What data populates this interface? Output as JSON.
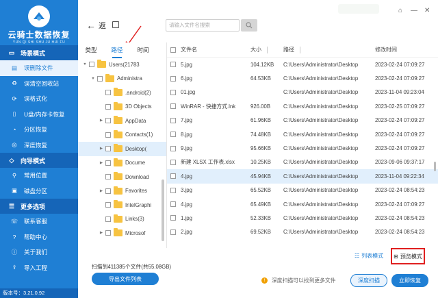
{
  "app": {
    "title": "云骑士数据恢复",
    "subtitle": "YUN QI SHI SHU JU HUI FU",
    "version": "版本号：3.21.0.92"
  },
  "sidebar": {
    "sections": [
      {
        "title": "场景模式",
        "items": [
          {
            "label": "误删除文件",
            "active": true
          },
          {
            "label": "误清空回收站"
          },
          {
            "label": "误格式化"
          },
          {
            "label": "U盘/内存卡恢复"
          },
          {
            "label": "分区恢复"
          },
          {
            "label": "深度恢复"
          }
        ]
      },
      {
        "title": "向导模式",
        "items": [
          {
            "label": "常用位置"
          },
          {
            "label": "磁盘分区"
          }
        ]
      },
      {
        "title": "更多选项",
        "items": [
          {
            "label": "联系客服"
          },
          {
            "label": "帮助中心"
          },
          {
            "label": "关于我们"
          },
          {
            "label": "导入工程"
          }
        ]
      }
    ]
  },
  "toolbar": {
    "back_label": "返",
    "search_placeholder": "请输入文件名搜索"
  },
  "tree": {
    "tabs": [
      "类型",
      "路径",
      "时间"
    ],
    "active_tab": 1,
    "rows": [
      {
        "label": "Users(21783",
        "indent": 0,
        "expand": "▼"
      },
      {
        "label": "Administra",
        "indent": 1,
        "expand": "▼"
      },
      {
        "label": ".android(2)",
        "indent": 2,
        "expand": ""
      },
      {
        "label": "3D Objects",
        "indent": 2,
        "expand": ""
      },
      {
        "label": "AppData",
        "indent": 2,
        "expand": "▶"
      },
      {
        "label": "Contacts(1)",
        "indent": 2,
        "expand": ""
      },
      {
        "label": "Desktop(",
        "indent": 2,
        "expand": "▶",
        "selected": true
      },
      {
        "label": "Docume",
        "indent": 2,
        "expand": "▶"
      },
      {
        "label": "Download",
        "indent": 2,
        "expand": ""
      },
      {
        "label": "Favorites",
        "indent": 2,
        "expand": "▶"
      },
      {
        "label": "IntelGraphi",
        "indent": 2,
        "expand": ""
      },
      {
        "label": "Links(3)",
        "indent": 2,
        "expand": ""
      },
      {
        "label": "Microsof",
        "indent": 2,
        "expand": "▶"
      }
    ]
  },
  "files": {
    "columns": [
      "文件名",
      "大小",
      "路径",
      "修改时间"
    ],
    "rows": [
      {
        "name": "5.jpg",
        "size": "104.12KB",
        "path": "C:\\Users\\Administrator\\Desktop",
        "date": "2023-02-24 07:09:27"
      },
      {
        "name": "6.jpg",
        "size": "64.53KB",
        "path": "C:\\Users\\Administrator\\Desktop",
        "date": "2023-02-24 07:09:27"
      },
      {
        "name": "01.jpg",
        "size": "",
        "path": "C:\\Users\\Administrator\\Desktop",
        "date": "2023-11-04 09:23:04"
      },
      {
        "name": "WinRAR - 快捷方式.lnk",
        "size": "926.00B",
        "path": "C:\\Users\\Administrator\\Desktop",
        "date": "2023-02-25 07:09:27"
      },
      {
        "name": "7.jpg",
        "size": "61.96KB",
        "path": "C:\\Users\\Administrator\\Desktop",
        "date": "2023-02-24 07:09:27"
      },
      {
        "name": "8.jpg",
        "size": "74.48KB",
        "path": "C:\\Users\\Administrator\\Desktop",
        "date": "2023-02-24 07:09:27"
      },
      {
        "name": "9.jpg",
        "size": "95.66KB",
        "path": "C:\\Users\\Administrator\\Desktop",
        "date": "2023-02-24 07:09:27"
      },
      {
        "name": "新建 XLSX 工作表.xlsx",
        "size": "10.25KB",
        "path": "C:\\Users\\Administrator\\Desktop",
        "date": "2023-09-06 09:37:17"
      },
      {
        "name": "4.jpg",
        "size": "45.94KB",
        "path": "C:\\Users\\Administrator\\Desktop",
        "date": "2023-11-04 09:22:34",
        "selected": true
      },
      {
        "name": "3.jpg",
        "size": "65.52KB",
        "path": "C:\\Users\\Administrator\\Desktop",
        "date": "2023-02-24 08:54:23"
      },
      {
        "name": "4.jpg",
        "size": "65.49KB",
        "path": "C:\\Users\\Administrator\\Desktop",
        "date": "2023-02-24 07:09:27"
      },
      {
        "name": "1.jpg",
        "size": "52.33KB",
        "path": "C:\\Users\\Administrator\\Desktop",
        "date": "2023-02-24 08:54:23"
      },
      {
        "name": "2.jpg",
        "size": "69.52KB",
        "path": "C:\\Users\\Administrator\\Desktop",
        "date": "2023-02-24 08:54:23"
      }
    ]
  },
  "bottom": {
    "list_mode": "列表模式",
    "preview_mode": "预览模式",
    "scan_info": "扫描到411385个文件(共55.08GB)",
    "export_label": "导出文件列表",
    "deep_tip": "深度扫描可以找到更多文件",
    "deep_scan_label": "深度扫描",
    "recover_label": "立即恢复"
  },
  "colors": {
    "accent": "#1f7fd4",
    "highlight": "#e02020",
    "folder": "#f7c341"
  }
}
